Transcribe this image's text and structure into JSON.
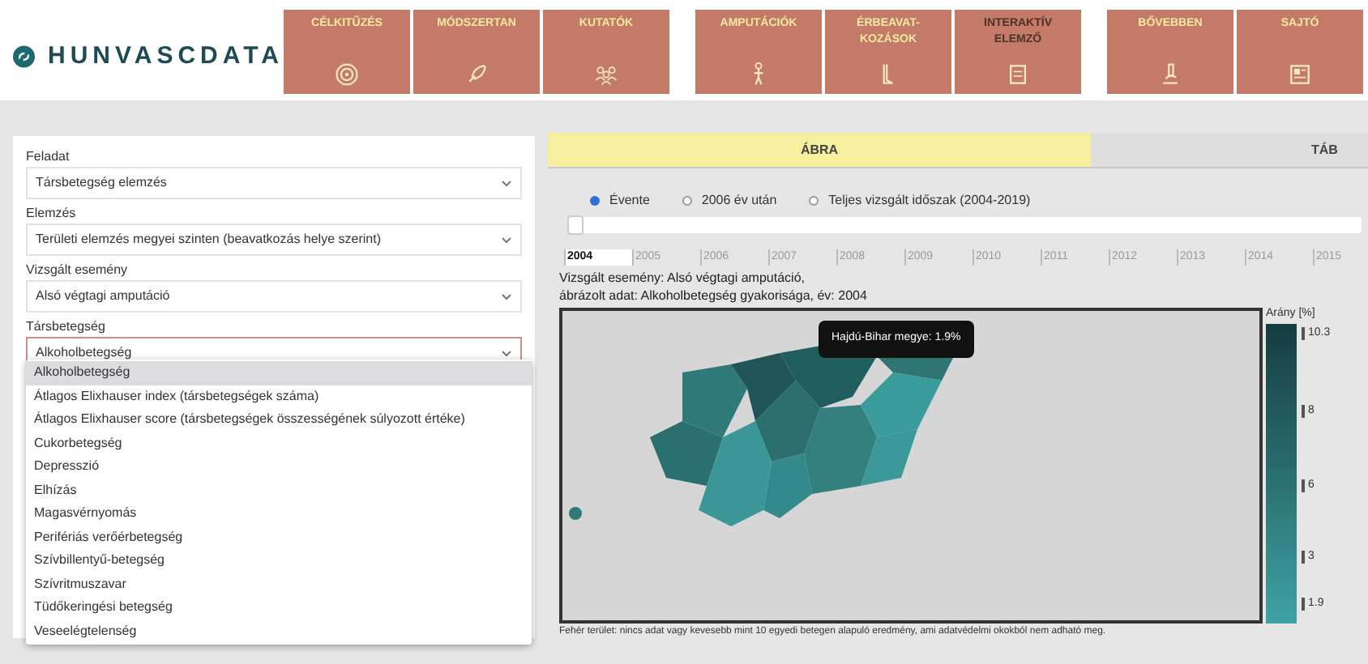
{
  "logo": {
    "text": "HUNVASCDATA"
  },
  "nav": [
    {
      "label": "CÉLKITŰZÉS",
      "active": false
    },
    {
      "label": "MÓDSZERTAN",
      "active": false
    },
    {
      "label": "KUTATÓK",
      "active": false
    },
    {
      "label": "AMPUTÁCIÓK",
      "active": false
    },
    {
      "label": "ÉRBEAVAT-KOZÁSOK",
      "active": false
    },
    {
      "label": "INTERAKTÍV ELEMZŐ",
      "active": true
    },
    {
      "label": "BŐVEBBEN",
      "active": false
    },
    {
      "label": "SAJTÓ",
      "active": false
    }
  ],
  "filters": [
    {
      "label": "Feladat",
      "value": "Társbetegség elemzés",
      "open": false
    },
    {
      "label": "Elemzés",
      "value": "Területi elemzés megyei szinten (beavatkozás helye szerint)",
      "open": false
    },
    {
      "label": "Vizsgált esemény",
      "value": "Alsó végtagi amputáció",
      "open": false
    },
    {
      "label": "Társbetegség",
      "value": "Alkoholbetegség",
      "open": true
    }
  ],
  "dropdown": [
    {
      "label": "Alkoholbetegség",
      "selected": true
    },
    {
      "label": "Átlagos Elixhauser index (társbetegségek száma)",
      "selected": false
    },
    {
      "label": "Átlagos Elixhauser score (társbetegségek összességének súlyozott értéke)",
      "selected": false
    },
    {
      "label": "Cukorbetegség",
      "selected": false
    },
    {
      "label": "Depresszió",
      "selected": false
    },
    {
      "label": "Elhízás",
      "selected": false
    },
    {
      "label": "Magasvérnyomás",
      "selected": false
    },
    {
      "label": "Perifériás verőérbetegség",
      "selected": false
    },
    {
      "label": "Szívbillentyű-betegség",
      "selected": false
    },
    {
      "label": "Szívritmuszavar",
      "selected": false
    },
    {
      "label": "Tüdőkeringési betegség",
      "selected": false
    },
    {
      "label": "Veseelégtelenség",
      "selected": false
    }
  ],
  "tabs": [
    {
      "label": "ÁBRA",
      "selected": true
    },
    {
      "label": "TÁB",
      "selected": false
    }
  ],
  "radios": [
    {
      "label": "Évente",
      "selected": true
    },
    {
      "label": "2006 év után",
      "selected": false
    },
    {
      "label": "Teljes vizsgált időszak (2004-2019)",
      "selected": false
    }
  ],
  "year_slider": {
    "level": 0
  },
  "years": [
    {
      "label": "2004",
      "selected": true
    },
    {
      "label": "2005",
      "selected": false
    },
    {
      "label": "2006",
      "selected": false
    },
    {
      "label": "2007",
      "selected": false
    },
    {
      "label": "2008",
      "selected": false
    },
    {
      "label": "2009",
      "selected": false
    },
    {
      "label": "2010",
      "selected": false
    },
    {
      "label": "2011",
      "selected": false
    },
    {
      "label": "2012",
      "selected": false
    },
    {
      "label": "2013",
      "selected": false
    },
    {
      "label": "2014",
      "selected": false
    },
    {
      "label": "2015",
      "selected": false
    }
  ],
  "captions": [
    "Vizsgált esemény: Alsó végtagi amputáció,",
    "ábrázolt adat: Alkoholbetegség gyakorisága, év: 2004"
  ],
  "tooltip": "Hajdú-Bihar megye: 1.9%",
  "legend": {
    "title": "Arány [%]",
    "ticks": [
      "10.3",
      "8",
      "6",
      "3",
      "1.9"
    ]
  },
  "footnote": "Fehér terület: nincs adat vagy kevesebb mint 10 egyedi betegen alapuló eredmény, ami adatvédelmi okokból nem adható meg."
}
